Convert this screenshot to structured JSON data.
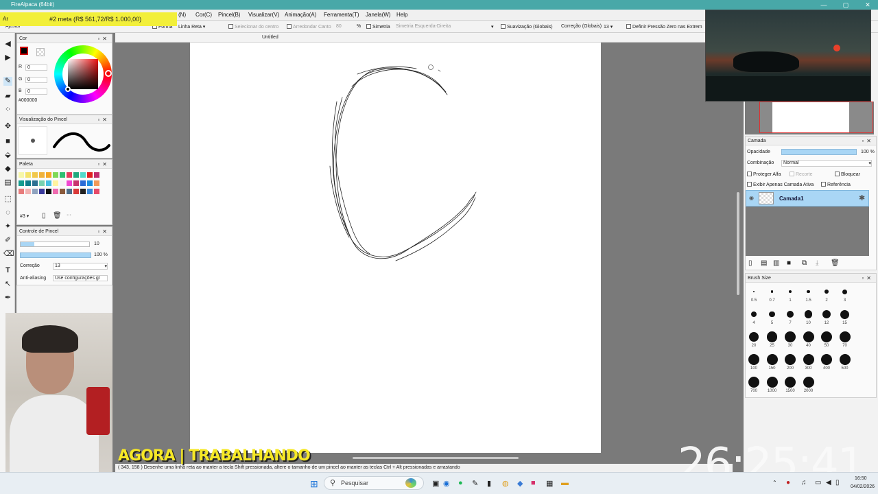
{
  "window": {
    "title": "FireAlpaca (64bit)",
    "doc_tab": "Untitled"
  },
  "goal_banner": "#2 meta (R$ 561,72/R$ 1.000,00)",
  "menu": [
    "(N)",
    "Cor(C)",
    "Pincel(B)",
    "Visualizar(V)",
    "Animação(A)",
    "Ferramenta(T)",
    "Janela(W)",
    "Help"
  ],
  "toolbar": {
    "ajustar": "Ajustar",
    "forma": "Forma",
    "forma_value": "Linha Reta",
    "selecionar_centro": "Selecionar do centro",
    "arredondar": "Arredondar Canto",
    "arredondar_value": "80",
    "percent": "%",
    "simetria": "Simetria",
    "simetria_value": "Simetria Esquerda-Direita",
    "suavizacao": "Suavização (Globais)",
    "correcao": "Correção (Globais)",
    "correcao_value": "13",
    "definir_pressao": "Definir Pressão Zero nas Extrem"
  },
  "color_panel": {
    "title": "Cor",
    "r_label": "R",
    "r_value": "0",
    "g_label": "G",
    "g_value": "0",
    "b_label": "B",
    "b_value": "0",
    "hex": "#000000"
  },
  "brush_preview": {
    "title": "Visualização do Pincel"
  },
  "palette": {
    "title": "Paleta",
    "index": "#3",
    "colors": [
      "#f7f7a8",
      "#f4e36b",
      "#f1c84b",
      "#f0b23a",
      "#f5a623",
      "#7ed957",
      "#2fbf71",
      "#e63c5c",
      "#1fa97d",
      "#53d9c9",
      "#e02020",
      "#c12a6b",
      "#149c8f",
      "#0f7d8a",
      "#2b6f91",
      "#78d1b0",
      "#48bfe3",
      "#fff3a0",
      "#f3f3f3",
      "#f046d0",
      "#c8346e",
      "#2a6bd6",
      "#1b8de0",
      "#f29a5a",
      "#e77b7b",
      "#f2b3b3",
      "#8fa3bf",
      "#3a3a9c",
      "#111111",
      "#ef6bb0",
      "#8a5a3c",
      "#4e6e8a",
      "#d93a3a",
      "#222222",
      "#3a88d9",
      "#e64b6a"
    ]
  },
  "brush_control": {
    "title": "Controle de Pincel",
    "size_value": "10",
    "opacity_value": "100 %",
    "correcao_label": "Correção",
    "correcao_value": "13",
    "antialias_label": "Anti-aliasing",
    "antialias_value": "Use configurações gl"
  },
  "layer_panel": {
    "title": "Camada",
    "opacidade": "Opacidade",
    "opacidade_value": "100 %",
    "opacidade_fraction": 1.0,
    "combinacao": "Combinação",
    "combinacao_value": "Normal",
    "proteger_alfa": "Proteger Alfa",
    "recorte": "Recorte",
    "bloquear": "Bloquear",
    "exibir_apenas": "Exibir Apenas Camada Ativa",
    "referencia": "Referência",
    "layer_name": "Camada1"
  },
  "brush_size": {
    "title": "Brush Size",
    "sizes": [
      "0.5",
      "0.7",
      "1",
      "1.5",
      "2",
      "3",
      "4",
      "5",
      "7",
      "10",
      "12",
      "15",
      "20",
      "25",
      "30",
      "40",
      "50",
      "70",
      "100",
      "150",
      "200",
      "300",
      "400",
      "500",
      "700",
      "1000",
      "1500",
      "2000"
    ]
  },
  "status_text": "( 343, 158 )   Desenhe uma linha reta ao manter a tecla Shift pressionada, altere o tamanho de um pincel ao manter as teclas Ctrl + Alt pressionadas e arrastando",
  "overlay": {
    "banner": "AGORA | TRABALHANDO",
    "clock": "26:25:41"
  },
  "taskbar": {
    "search_placeholder": "Pesquisar",
    "time": "16:50",
    "date": "04/02/2026"
  },
  "colors": {
    "titlebar": "#48a8a8",
    "goal_bg": "#f2ef3a",
    "layer_selected": "#a9d6f5",
    "slider_fill": "#a9d6f5",
    "banner_text": "#f6e826"
  }
}
